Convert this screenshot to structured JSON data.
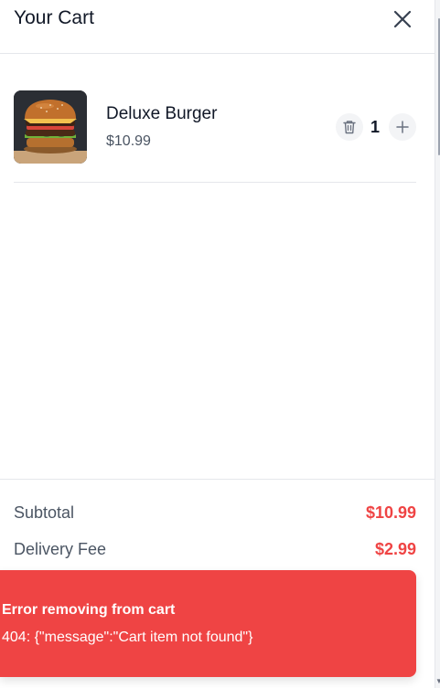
{
  "cart": {
    "title": "Your Cart",
    "close_icon": "close-icon"
  },
  "items": [
    {
      "name": "Deluxe Burger",
      "price": "$10.99",
      "quantity": "1",
      "image": "burger-photo",
      "remove_icon": "trash-icon",
      "increase_icon": "plus-icon"
    }
  ],
  "summary": {
    "subtotal_label": "Subtotal",
    "subtotal_value": "$10.99",
    "delivery_label": "Delivery Fee",
    "delivery_value": "$2.99"
  },
  "toast": {
    "title": "Error removing from cart",
    "message": "404: {\"message\":\"Cart item not found\"}"
  },
  "colors": {
    "accent": "#ef4444",
    "text": "#111827",
    "muted": "#4b5563",
    "button_bg": "#f3f4f6"
  }
}
